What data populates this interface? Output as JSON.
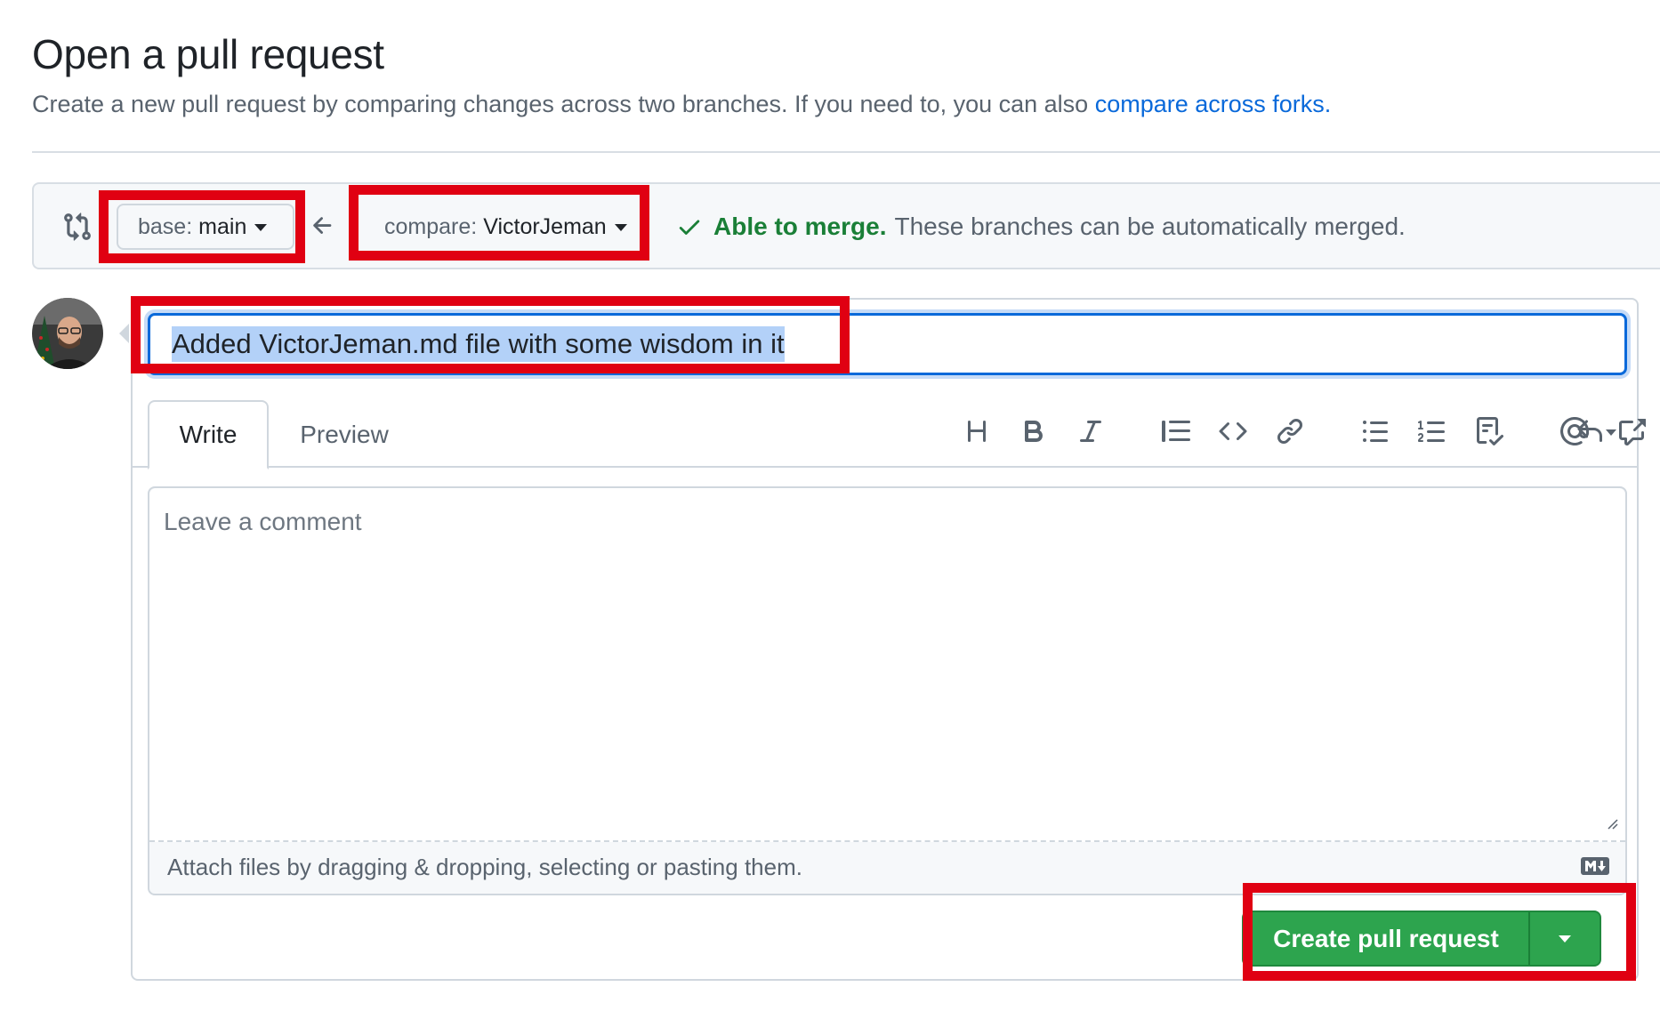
{
  "header": {
    "title": "Open a pull request",
    "subtitle": "Create a new pull request by comparing changes across two branches. If you need to, you can also ",
    "subtitle_link": "compare across forks."
  },
  "compare": {
    "base_prefix": "base:",
    "base_branch": "main",
    "compare_prefix": "compare:",
    "compare_branch": "VictorJeman",
    "merge_status_bold": "Able to merge.",
    "merge_status_text": "These branches can be automatically merged."
  },
  "composer": {
    "title_value": "Added VictorJeman.md file with some wisdom in it",
    "tabs": [
      {
        "label": "Write",
        "active": true
      },
      {
        "label": "Preview",
        "active": false
      }
    ],
    "toolbar_icons": [
      "heading-icon",
      "bold-icon",
      "italic-icon",
      "quote-icon",
      "code-icon",
      "link-icon",
      "unordered-list-icon",
      "ordered-list-icon",
      "task-list-icon",
      "mention-icon",
      "cross-reference-icon",
      "saved-reply-icon"
    ],
    "comment_placeholder": "Leave a comment",
    "attach_text": "Attach files by dragging & dropping, selecting or pasting them.",
    "create_label": "Create pull request"
  },
  "colors": {
    "accent_blue": "#0969da",
    "merge_green": "#1a7f37",
    "button_green": "#2da44e",
    "highlight_red": "#e00012"
  }
}
